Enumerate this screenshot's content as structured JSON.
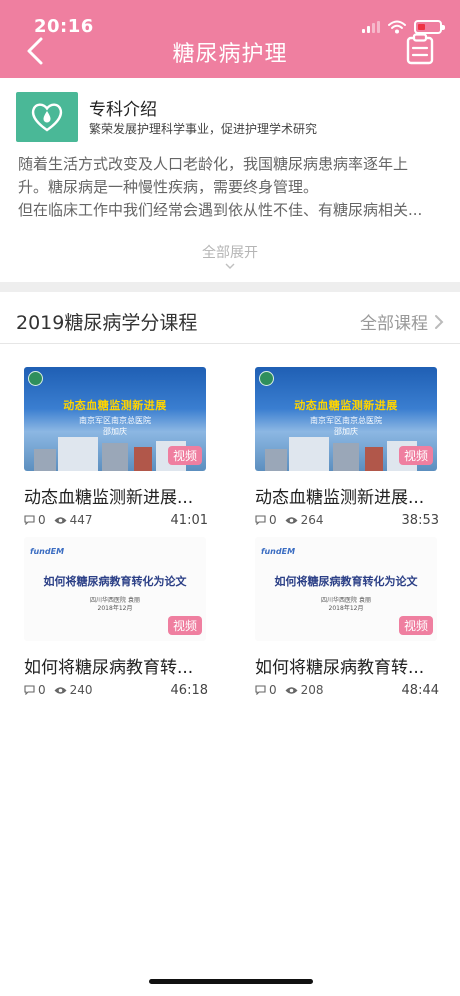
{
  "status_bar": {
    "time": "20:16"
  },
  "header": {
    "title": "糖尿病护理",
    "back_icon": "chevron-left-icon",
    "right_icon": "clipboard-icon",
    "color": "#ef7fa0"
  },
  "intro": {
    "name": "专科介绍",
    "slogan": "繁荣发展护理科学事业，促进护理学术研究",
    "lines": [
      "随着生活方式改变及人口老龄化，我国糖尿病患病率逐年上",
      "升。糖尿病是一种慢性疾病，需要终身管理。",
      "但在临床工作中我们经常会遇到依从性不佳、有糖尿病相关..."
    ],
    "expand_label": "全部展开",
    "logo_color": "#4ab897"
  },
  "section": {
    "title": "2019糖尿病学分课程",
    "more_label": "全部课程"
  },
  "courses": [
    {
      "title": "动态血糖监测新进展...",
      "badge": "视频",
      "comments": "0",
      "views": "447",
      "duration": "41:01",
      "thumb_title": "动态血糖监测新进展",
      "thumb_sub1": "南京军区南京总医院",
      "thumb_sub2": "邵加庆"
    },
    {
      "title": "动态血糖监测新进展...",
      "badge": "视频",
      "comments": "0",
      "views": "264",
      "duration": "38:53",
      "thumb_title": "动态血糖监测新进展",
      "thumb_sub1": "南京军区南京总医院",
      "thumb_sub2": "邵加庆"
    },
    {
      "title": "如何将糖尿病教育转...",
      "badge": "视频",
      "comments": "0",
      "views": "240",
      "duration": "46:18",
      "thumb_title": "如何将糖尿病教育转化为论文",
      "thumb_sub1": "四川华西医院 袁丽",
      "thumb_sub2": "2018年12月"
    },
    {
      "title": "如何将糖尿病教育转...",
      "badge": "视频",
      "comments": "0",
      "views": "208",
      "duration": "48:44",
      "thumb_title": "如何将糖尿病教育转化为论文",
      "thumb_sub1": "四川华西医院 袁丽",
      "thumb_sub2": "2018年12月"
    }
  ]
}
